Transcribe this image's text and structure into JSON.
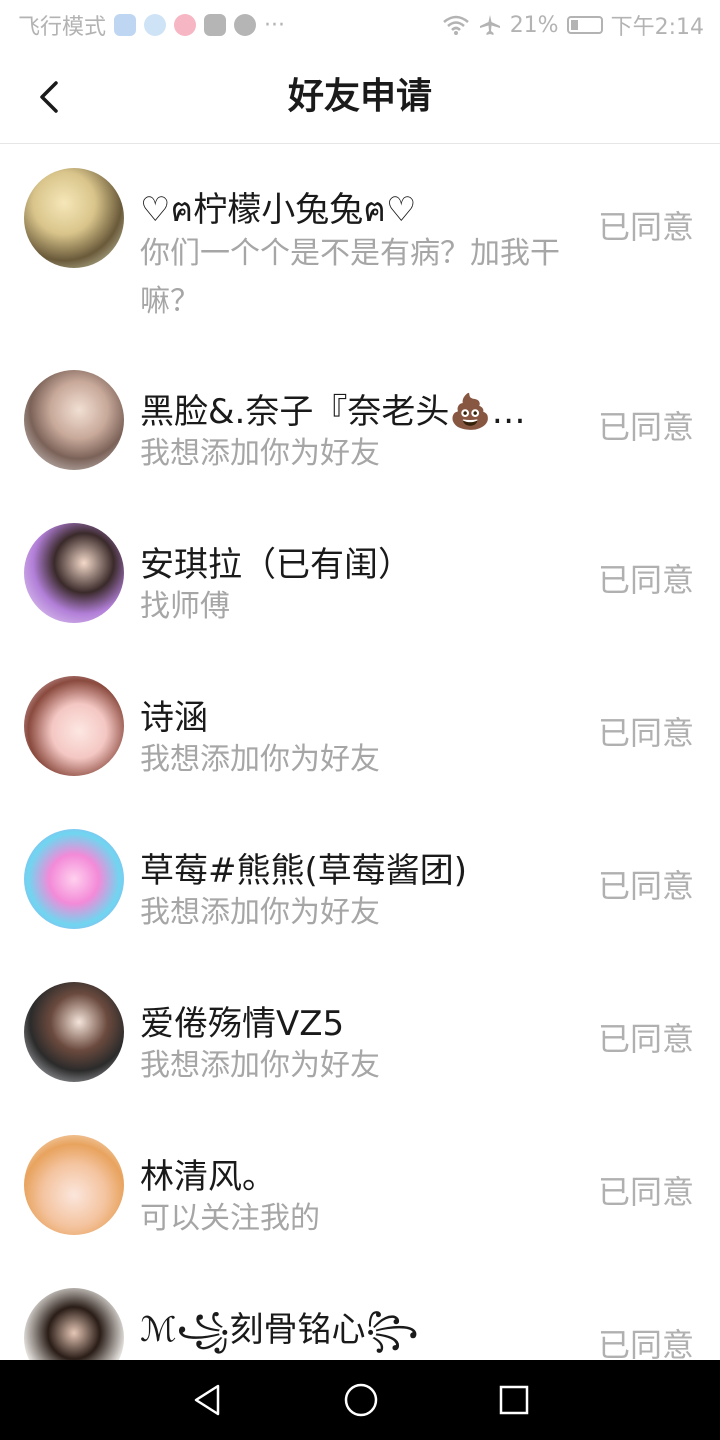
{
  "status_bar": {
    "left_text": "飞行模式",
    "more": "···",
    "battery": "21%",
    "time": "下午2:14"
  },
  "header": {
    "title": "好友申请"
  },
  "requests": [
    {
      "name": "♡ฅ柠檬小兔兔ฅ♡",
      "message": "你们一个个是不是有病？加我干嘛？",
      "status": "已同意"
    },
    {
      "name": "黑脸&.奈子『奈老头💩…",
      "message": "我想添加你为好友",
      "status": "已同意"
    },
    {
      "name": "安琪拉（已有闺）",
      "message": "找师傅",
      "status": "已同意"
    },
    {
      "name": "诗涵",
      "message": "我想添加你为好友",
      "status": "已同意"
    },
    {
      "name": "草莓#熊熊(草莓酱团)",
      "message": "我想添加你为好友",
      "status": "已同意"
    },
    {
      "name": "爱倦殇情VZ5",
      "message": "我想添加你为好友",
      "status": "已同意"
    },
    {
      "name": "林清风。",
      "message": "可以关注我的",
      "status": "已同意"
    },
    {
      "name": "ℳ꧁刻骨铭心꧂",
      "message": "",
      "status": "已同意"
    }
  ],
  "colors": {
    "title": "#1a1a1a",
    "message": "#a6a6a6",
    "status": "#b0b0b0",
    "divider": "#e6e6e6",
    "system_nav": "#000000"
  },
  "icons": [
    "back-arrow-icon",
    "wifi-icon",
    "airplane-icon",
    "battery-icon",
    "nav-back-icon",
    "nav-home-icon",
    "nav-recents-icon"
  ]
}
